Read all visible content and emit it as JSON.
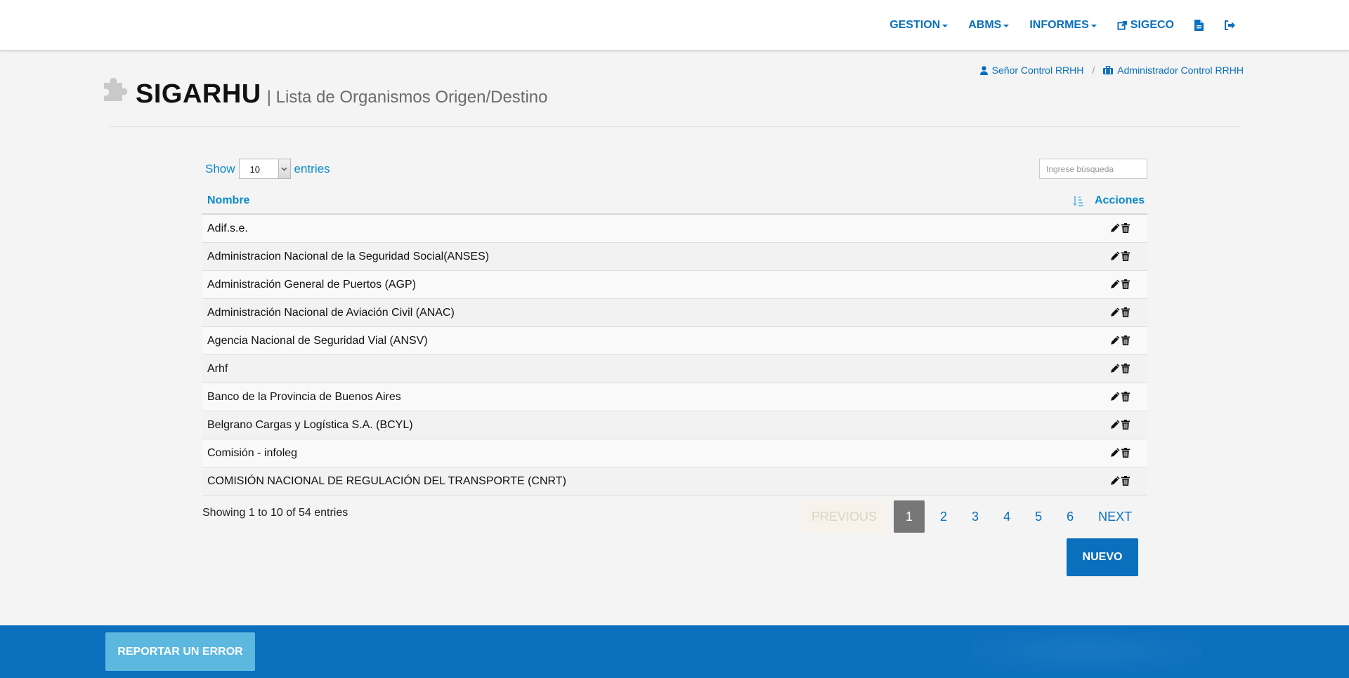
{
  "nav": {
    "items": [
      {
        "label": "GESTION",
        "dropdown": true
      },
      {
        "label": "ABMS",
        "dropdown": true
      },
      {
        "label": "INFORMES",
        "dropdown": true
      }
    ],
    "sigeco_label": "SIGECO",
    "sigeco_icon": "external-link-icon",
    "doc_icon": "document-icon",
    "logout_icon": "sign-out-icon"
  },
  "user": {
    "name": "Señor Control RRHH",
    "name_icon": "user-icon",
    "separator": "/",
    "role": "Administrador Control RRHH",
    "role_icon": "briefcase-icon"
  },
  "header": {
    "icon": "puzzle-icon",
    "title": "SIGARHU",
    "subtitle": "| Lista de Organismos Origen/Destino"
  },
  "table_controls": {
    "show_label": "Show",
    "entries_value": "10",
    "entries_label": "entries",
    "search_placeholder": "Ingrese búsqueda"
  },
  "table": {
    "columns": [
      "Nombre",
      "Acciones"
    ],
    "sort_icon": "sort-amount-icon",
    "rows": [
      "Adif.s.e.",
      "Administracion Nacional de la Seguridad Social(ANSES)",
      "Administración General de Puertos (AGP)",
      "Administración Nacional de Aviación Civil (ANAC)",
      "Agencia Nacional de Seguridad Vial (ANSV)",
      "Arhf",
      "Banco de la Provincia de Buenos Aires",
      "Belgrano Cargas y Logística S.A. (BCYL)",
      "Comisión - infoleg",
      "COMISIÓN NACIONAL DE REGULACIÓN DEL TRANSPORTE (CNRT)"
    ],
    "action_icons": [
      "pencil-icon",
      "trash-icon"
    ]
  },
  "pagination": {
    "info": "Showing 1 to 10 of 54 entries",
    "previous": "PREVIOUS",
    "pages": [
      "1",
      "2",
      "3",
      "4",
      "5",
      "6"
    ],
    "active_page": "1",
    "next": "NEXT"
  },
  "buttons": {
    "nuevo": "NUEVO",
    "report": "REPORTAR UN ERROR"
  },
  "colors": {
    "primary": "#0a6fbd",
    "link": "#0a8acb",
    "report_button": "#5cb8df",
    "active_page": "#777777"
  }
}
